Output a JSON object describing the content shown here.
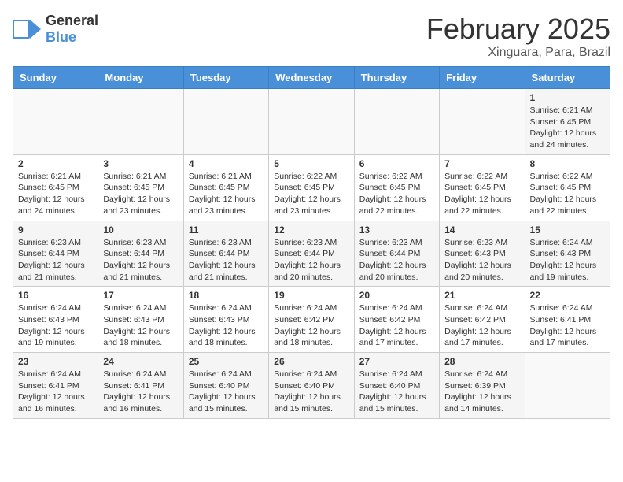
{
  "header": {
    "logo_general": "General",
    "logo_blue": "Blue",
    "month_title": "February 2025",
    "location": "Xinguara, Para, Brazil"
  },
  "weekdays": [
    "Sunday",
    "Monday",
    "Tuesday",
    "Wednesday",
    "Thursday",
    "Friday",
    "Saturday"
  ],
  "weeks": [
    [
      {
        "day": "",
        "info": ""
      },
      {
        "day": "",
        "info": ""
      },
      {
        "day": "",
        "info": ""
      },
      {
        "day": "",
        "info": ""
      },
      {
        "day": "",
        "info": ""
      },
      {
        "day": "",
        "info": ""
      },
      {
        "day": "1",
        "info": "Sunrise: 6:21 AM\nSunset: 6:45 PM\nDaylight: 12 hours and 24 minutes."
      }
    ],
    [
      {
        "day": "2",
        "info": "Sunrise: 6:21 AM\nSunset: 6:45 PM\nDaylight: 12 hours and 24 minutes."
      },
      {
        "day": "3",
        "info": "Sunrise: 6:21 AM\nSunset: 6:45 PM\nDaylight: 12 hours and 23 minutes."
      },
      {
        "day": "4",
        "info": "Sunrise: 6:21 AM\nSunset: 6:45 PM\nDaylight: 12 hours and 23 minutes."
      },
      {
        "day": "5",
        "info": "Sunrise: 6:22 AM\nSunset: 6:45 PM\nDaylight: 12 hours and 23 minutes."
      },
      {
        "day": "6",
        "info": "Sunrise: 6:22 AM\nSunset: 6:45 PM\nDaylight: 12 hours and 22 minutes."
      },
      {
        "day": "7",
        "info": "Sunrise: 6:22 AM\nSunset: 6:45 PM\nDaylight: 12 hours and 22 minutes."
      },
      {
        "day": "8",
        "info": "Sunrise: 6:22 AM\nSunset: 6:45 PM\nDaylight: 12 hours and 22 minutes."
      }
    ],
    [
      {
        "day": "9",
        "info": "Sunrise: 6:23 AM\nSunset: 6:44 PM\nDaylight: 12 hours and 21 minutes."
      },
      {
        "day": "10",
        "info": "Sunrise: 6:23 AM\nSunset: 6:44 PM\nDaylight: 12 hours and 21 minutes."
      },
      {
        "day": "11",
        "info": "Sunrise: 6:23 AM\nSunset: 6:44 PM\nDaylight: 12 hours and 21 minutes."
      },
      {
        "day": "12",
        "info": "Sunrise: 6:23 AM\nSunset: 6:44 PM\nDaylight: 12 hours and 20 minutes."
      },
      {
        "day": "13",
        "info": "Sunrise: 6:23 AM\nSunset: 6:44 PM\nDaylight: 12 hours and 20 minutes."
      },
      {
        "day": "14",
        "info": "Sunrise: 6:23 AM\nSunset: 6:43 PM\nDaylight: 12 hours and 20 minutes."
      },
      {
        "day": "15",
        "info": "Sunrise: 6:24 AM\nSunset: 6:43 PM\nDaylight: 12 hours and 19 minutes."
      }
    ],
    [
      {
        "day": "16",
        "info": "Sunrise: 6:24 AM\nSunset: 6:43 PM\nDaylight: 12 hours and 19 minutes."
      },
      {
        "day": "17",
        "info": "Sunrise: 6:24 AM\nSunset: 6:43 PM\nDaylight: 12 hours and 18 minutes."
      },
      {
        "day": "18",
        "info": "Sunrise: 6:24 AM\nSunset: 6:43 PM\nDaylight: 12 hours and 18 minutes."
      },
      {
        "day": "19",
        "info": "Sunrise: 6:24 AM\nSunset: 6:42 PM\nDaylight: 12 hours and 18 minutes."
      },
      {
        "day": "20",
        "info": "Sunrise: 6:24 AM\nSunset: 6:42 PM\nDaylight: 12 hours and 17 minutes."
      },
      {
        "day": "21",
        "info": "Sunrise: 6:24 AM\nSunset: 6:42 PM\nDaylight: 12 hours and 17 minutes."
      },
      {
        "day": "22",
        "info": "Sunrise: 6:24 AM\nSunset: 6:41 PM\nDaylight: 12 hours and 17 minutes."
      }
    ],
    [
      {
        "day": "23",
        "info": "Sunrise: 6:24 AM\nSunset: 6:41 PM\nDaylight: 12 hours and 16 minutes."
      },
      {
        "day": "24",
        "info": "Sunrise: 6:24 AM\nSunset: 6:41 PM\nDaylight: 12 hours and 16 minutes."
      },
      {
        "day": "25",
        "info": "Sunrise: 6:24 AM\nSunset: 6:40 PM\nDaylight: 12 hours and 15 minutes."
      },
      {
        "day": "26",
        "info": "Sunrise: 6:24 AM\nSunset: 6:40 PM\nDaylight: 12 hours and 15 minutes."
      },
      {
        "day": "27",
        "info": "Sunrise: 6:24 AM\nSunset: 6:40 PM\nDaylight: 12 hours and 15 minutes."
      },
      {
        "day": "28",
        "info": "Sunrise: 6:24 AM\nSunset: 6:39 PM\nDaylight: 12 hours and 14 minutes."
      },
      {
        "day": "",
        "info": ""
      }
    ]
  ]
}
